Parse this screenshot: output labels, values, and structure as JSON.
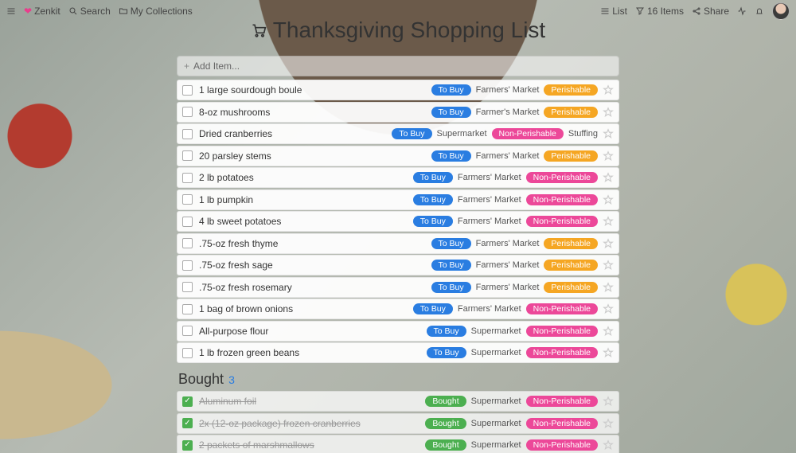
{
  "topbar": {
    "brand": "Zenkit",
    "search": "Search",
    "collections": "My Collections",
    "view": "List",
    "items_count": "16 Items",
    "share": "Share"
  },
  "title": "Thanksgiving Shopping List",
  "add_placeholder": "Add Item...",
  "status_labels": {
    "tobuy": "To Buy",
    "bought": "Bought"
  },
  "perish_labels": {
    "perish": "Perishable",
    "nonperish": "Non-Perishable"
  },
  "items": [
    {
      "name": "1 large sourdough boule",
      "status": "tobuy",
      "source": "Farmers' Market",
      "perish": "perish"
    },
    {
      "name": "8-oz mushrooms",
      "status": "tobuy",
      "source": "Farmer's Market",
      "perish": "perish"
    },
    {
      "name": "Dried cranberries",
      "status": "tobuy",
      "source": "Supermarket",
      "perish": "nonperish",
      "extra": "Stuffing"
    },
    {
      "name": "20 parsley stems",
      "status": "tobuy",
      "source": "Farmers' Market",
      "perish": "perish"
    },
    {
      "name": "2 lb potatoes",
      "status": "tobuy",
      "source": "Farmers' Market",
      "perish": "nonperish"
    },
    {
      "name": "1 lb pumpkin",
      "status": "tobuy",
      "source": "Farmers' Market",
      "perish": "nonperish"
    },
    {
      "name": "4 lb sweet potatoes",
      "status": "tobuy",
      "source": "Farmers' Market",
      "perish": "nonperish"
    },
    {
      "name": ".75-oz fresh thyme",
      "status": "tobuy",
      "source": "Farmers' Market",
      "perish": "perish"
    },
    {
      "name": ".75-oz fresh sage",
      "status": "tobuy",
      "source": "Farmers' Market",
      "perish": "perish"
    },
    {
      "name": ".75-oz fresh rosemary",
      "status": "tobuy",
      "source": "Farmers' Market",
      "perish": "perish"
    },
    {
      "name": "1 bag of brown onions",
      "status": "tobuy",
      "source": "Farmers' Market",
      "perish": "nonperish"
    },
    {
      "name": "All-purpose flour",
      "status": "tobuy",
      "source": "Supermarket",
      "perish": "nonperish"
    },
    {
      "name": "1 lb frozen green beans",
      "status": "tobuy",
      "source": "Supermarket",
      "perish": "nonperish"
    }
  ],
  "bought_section": {
    "label": "Bought",
    "count": "3"
  },
  "bought_items": [
    {
      "name": "Aluminum foil",
      "status": "bought",
      "source": "Supermarket",
      "perish": "nonperish"
    },
    {
      "name": "2x (12-oz package) frozen cranberries",
      "status": "bought",
      "source": "Supermarket",
      "perish": "nonperish"
    },
    {
      "name": "2 packets of marshmallows",
      "status": "bought",
      "source": "Supermarket",
      "perish": "nonperish"
    }
  ]
}
